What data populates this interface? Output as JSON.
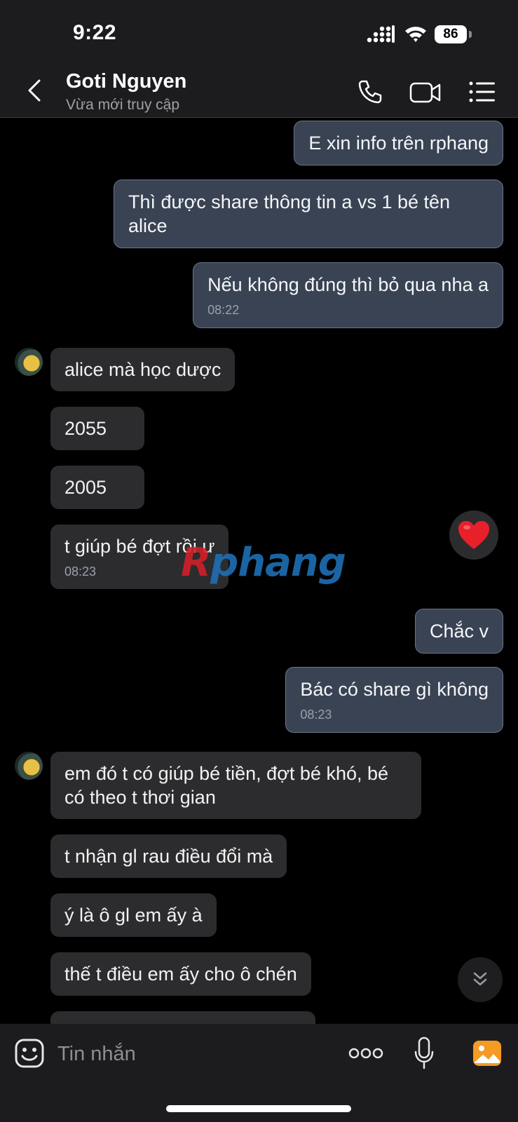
{
  "status_bar": {
    "time": "9:22",
    "battery": "86"
  },
  "header": {
    "contact_name": "Goti Nguyen",
    "contact_status": "Vừa mới truy cập"
  },
  "messages": [
    {
      "dir": "out",
      "text": "E xin info trên rphang"
    },
    {
      "dir": "out",
      "text": "Thì được share thông tin a vs 1 bé tên alice"
    },
    {
      "dir": "out",
      "text": "Nếu không đúng thì bỏ qua nha a",
      "time": "08:22"
    },
    {
      "dir": "in",
      "text": "alice mà học dược"
    },
    {
      "dir": "in",
      "text": "2055"
    },
    {
      "dir": "in",
      "text": "2005"
    },
    {
      "dir": "in",
      "text": "t giúp bé đợt rồi ư",
      "time": "08:23"
    },
    {
      "dir": "out",
      "text": "Chắc v"
    },
    {
      "dir": "out",
      "text": "Bác có share gì không",
      "time": "08:23"
    },
    {
      "dir": "in",
      "text": "em đó t có giúp bé tiền, đợt bé khó, bé có theo t thơi gian"
    },
    {
      "dir": "in",
      "text": "t nhận gl rau điều đổi mà"
    },
    {
      "dir": "in",
      "text": "ý là ô gl em ấy à"
    },
    {
      "dir": "in",
      "text": "thế t điều em ấy cho ô chén"
    }
  ],
  "reaction": {
    "icon": "heart-icon",
    "color": "#e8202a"
  },
  "watermark": {
    "part1": "R",
    "part2": "phang"
  },
  "composer": {
    "placeholder": "Tin nhắn"
  },
  "colors": {
    "outgoing_bubble": "#3a4353",
    "incoming_bubble": "#2c2c2e",
    "image_button": "#f59a23"
  }
}
